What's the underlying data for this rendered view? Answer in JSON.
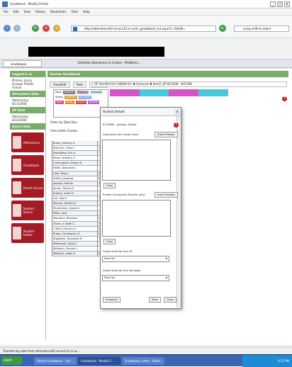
{
  "browser": {
    "title": "Gradebook - Mozilla Firefox",
    "menu": [
      "File",
      "Edit",
      "View",
      "History",
      "Bookmarks",
      "Tools",
      "Help"
    ],
    "url": "http://attendance02.mcas.k12.in.us/m_gradebook_ind.aspx?C=%H3E=",
    "search_text": "using shift to select",
    "bookmarks_left": "Tommy Hutton",
    "bookmarks_right": [
      "School Center Login",
      "Webpage",
      "Pandora",
      "The_Human_Calc.txt..."
    ],
    "tab_active": "Gradebook",
    "tab_other": "EdVantia Attendance & Grades - PiGWorks...",
    "status_text": "Transferring data from attendance02.mcas.k12.in.us..."
  },
  "sidebar": {
    "logged_in_header": "Logged in as",
    "logged_in_text": "Mcaree, Jenny Krueger Middle School",
    "attendance_header": "Attendance Date",
    "attendance_date": "Wednesday 8/13/2008",
    "gp_header": "GP Date",
    "gp_date": "Wednesday 8/13/2008",
    "quicklinks_header": "Quick Links",
    "quicklinks": [
      "Attendance",
      "Gradebook",
      "Parent Access",
      "Student Search",
      "Student Labels"
    ]
  },
  "main": {
    "header": "Teacher Gradebook",
    "nav": [
      "View/Edit",
      "Tools",
      "Reports"
    ],
    "filter_text": "GP   Tech/Ed Prd (18000-01)   ▼  Sciencee  ▼  Sem2_GP  8/13/08 - 8/21/08",
    "legend": {
      "row1": [
        "None",
        "Normal",
        "Missing",
        "Excused"
      ],
      "row2": [
        "Status",
        "Late/No",
        "Excused"
      ],
      "row3": [
        "Late",
        "Tardy",
        "Inc/Ltr",
        "Excuse"
      ]
    },
    "links": [
      "Order by Data Due",
      "View Letter Grades"
    ],
    "students": [
      "Bulze, Zachary A",
      "Brennan, Chloe J",
      "Bowalding, Eric A",
      "Baum, Anthony C",
      "Cunningham, Raven N",
      "Fields, Devontae L",
      "Gant, Riley J",
      "Griffin, Jonathan",
      "Jackson, Pamila",
      "James, Trevon D",
      "Kramer, Kristi D",
      "Lee, Mya E",
      "Monroe, Dallian N",
      "Mccammon, Jessica L",
      "Miller, Joey",
      "Mondano, Brandon",
      "Oliver, Jr. Keith C",
      "O'Neill, Zachary S",
      "Rubio, Christopher D",
      "Stapleton, Tanyasha M",
      "Waterman, Devin J",
      "Wildman, Samuel L",
      "Williams, Justin D"
    ],
    "student_values": [
      "",
      "5",
      "",
      "",
      "",
      "",
      "5",
      "10",
      "5",
      "",
      "",
      "5",
      "",
      "",
      "",
      "10",
      "5",
      "10",
      "10",
      "5",
      "",
      "",
      "10"
    ]
  },
  "modal": {
    "title": "Student Details",
    "student": "8113988 - Jackson, Pamila",
    "comments_label": "Comments (for Grade Card)",
    "insert_preset": "Insert Presets",
    "clear": "Clear",
    "private_label": "Private Comments (Teacher only)",
    "insert_preset2": "Insert Presets",
    "clear2": "Clear",
    "gp_grade_label": "Grade Scale for this GP",
    "gp_grade_value": "Pass Fail",
    "sem_grade_label": "Grade Scale for this Semester",
    "sem_grade_value": "Pass Fail",
    "snapshot": "Snapshot",
    "save": "Save",
    "close": "Close"
  },
  "taskbar": {
    "start": "start",
    "items": [
      "Online Gradebook - Sim...",
      "Gradebook - Mozilla F...",
      "Gradebook_notes - Notes"
    ],
    "clock": "4:15 PM"
  },
  "colors": {
    "green_header": "#7aac6a",
    "quicklink_red": "#a31c24",
    "taskbar_blue": "#3a64b4"
  }
}
